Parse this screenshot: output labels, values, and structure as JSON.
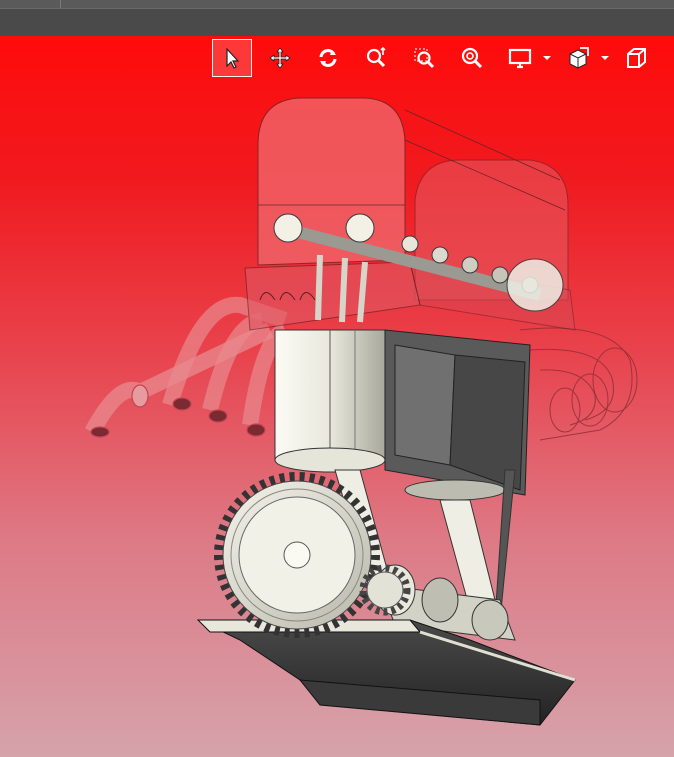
{
  "window": {
    "title": ""
  },
  "toolbar": {
    "buttons": [
      {
        "id": "select",
        "icon": "pointer-icon",
        "tooltip": ""
      },
      {
        "id": "pan",
        "icon": "pan-arrows-icon",
        "tooltip": ""
      },
      {
        "id": "rotate",
        "icon": "rotate-icon",
        "tooltip": ""
      },
      {
        "id": "zoom-dynamic",
        "icon": "zoom-dynamic-icon",
        "tooltip": ""
      },
      {
        "id": "zoom-window",
        "icon": "zoom-window-icon",
        "tooltip": ""
      },
      {
        "id": "zoom-fit",
        "icon": "zoom-fit-icon",
        "tooltip": ""
      },
      {
        "id": "display-mode",
        "icon": "monitor-icon",
        "tooltip": ""
      },
      {
        "id": "section-view",
        "icon": "section-cube-icon",
        "tooltip": ""
      },
      {
        "id": "standard-view",
        "icon": "cube-view-icon",
        "tooltip": ""
      }
    ],
    "active": "select"
  },
  "viewport": {
    "background_top": "#ff0b0b",
    "background_bottom": "#d6a3ab",
    "model": "engine-assembly"
  }
}
